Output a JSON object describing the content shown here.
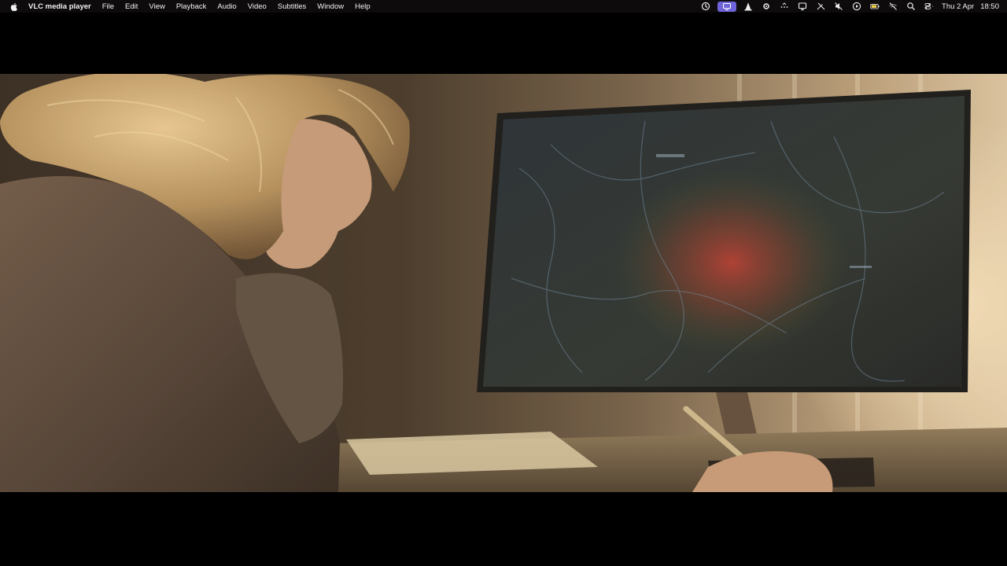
{
  "menubar": {
    "app_name": "VLC media player",
    "items": [
      "File",
      "Edit",
      "View",
      "Playback",
      "Audio",
      "Video",
      "Subtitles",
      "Window",
      "Help"
    ],
    "status_icons": [
      "screen-time-icon",
      "screen-share-icon",
      "vlc-cone-icon",
      "settings-sun-icon",
      "dots-menu-icon",
      "display-icon",
      "pen-off-icon",
      "mute-icon",
      "play-circle-icon",
      "battery-icon",
      "wifi-off-icon",
      "search-icon",
      "control-center-icon"
    ],
    "clock_date": "Thu 2 Apr",
    "clock_time": "18:50"
  },
  "colors": {
    "menubar_bg": "#0e0b0c",
    "active_icon_bg": "#6e63d8",
    "letterbox": "#000000"
  }
}
